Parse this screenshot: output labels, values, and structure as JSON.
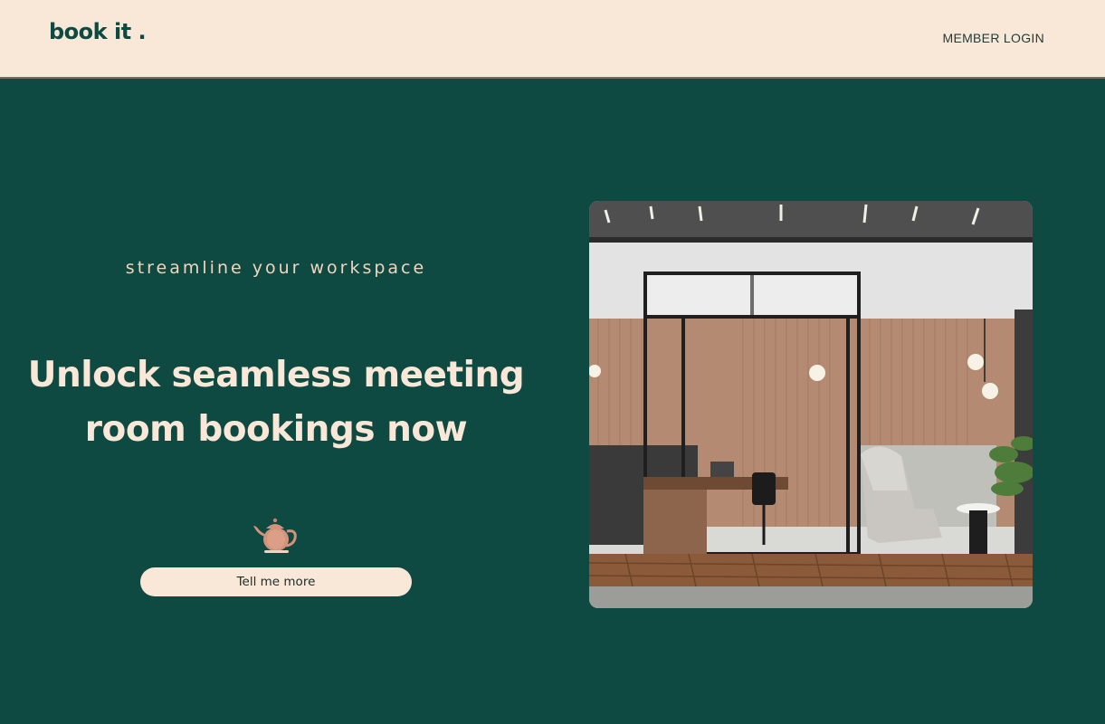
{
  "header": {
    "logo": "book it .",
    "login_label": "MEMBER LOGIN"
  },
  "hero": {
    "tagline": "streamline your workspace",
    "headline_line1": "Unlock seamless meeting",
    "headline_line2": "room bookings now",
    "cta_label": "Tell me more",
    "icon": "teapot-icon",
    "image": "meeting-room-photo"
  },
  "colors": {
    "brand_green": "#0f4a42",
    "cream": "#f9e8d8",
    "teapot": "#d4927a"
  }
}
